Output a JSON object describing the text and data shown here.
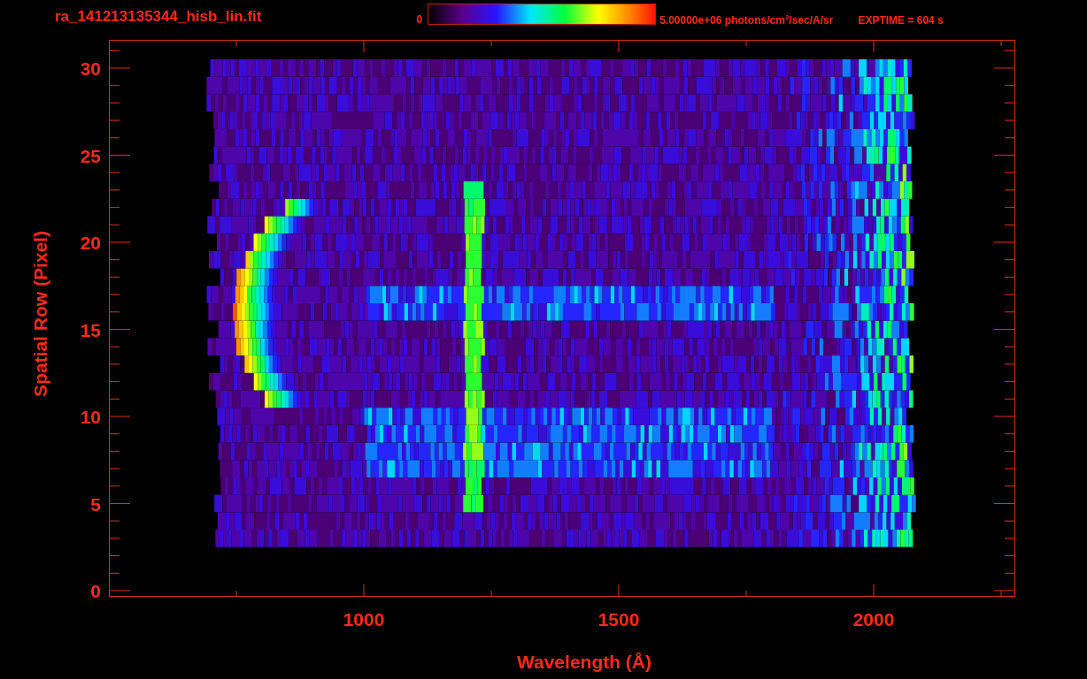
{
  "title": "ra_141213135344_hisb_lin.fit",
  "colorbar": {
    "min_label": "0",
    "max_label": "5.00000e+06 photons/cm$^{2}$/sec/A/sr"
  },
  "exposure": "EXPTIME = 604 s",
  "plot": {
    "xlabel": "Wavelength (Å)",
    "ylabel": "Spatial Row (Pixel)",
    "xticks": [
      "1000",
      "1500",
      "2000"
    ],
    "yticks": [
      "30",
      "25",
      "20",
      "15",
      "10",
      "5",
      "0"
    ]
  }
}
